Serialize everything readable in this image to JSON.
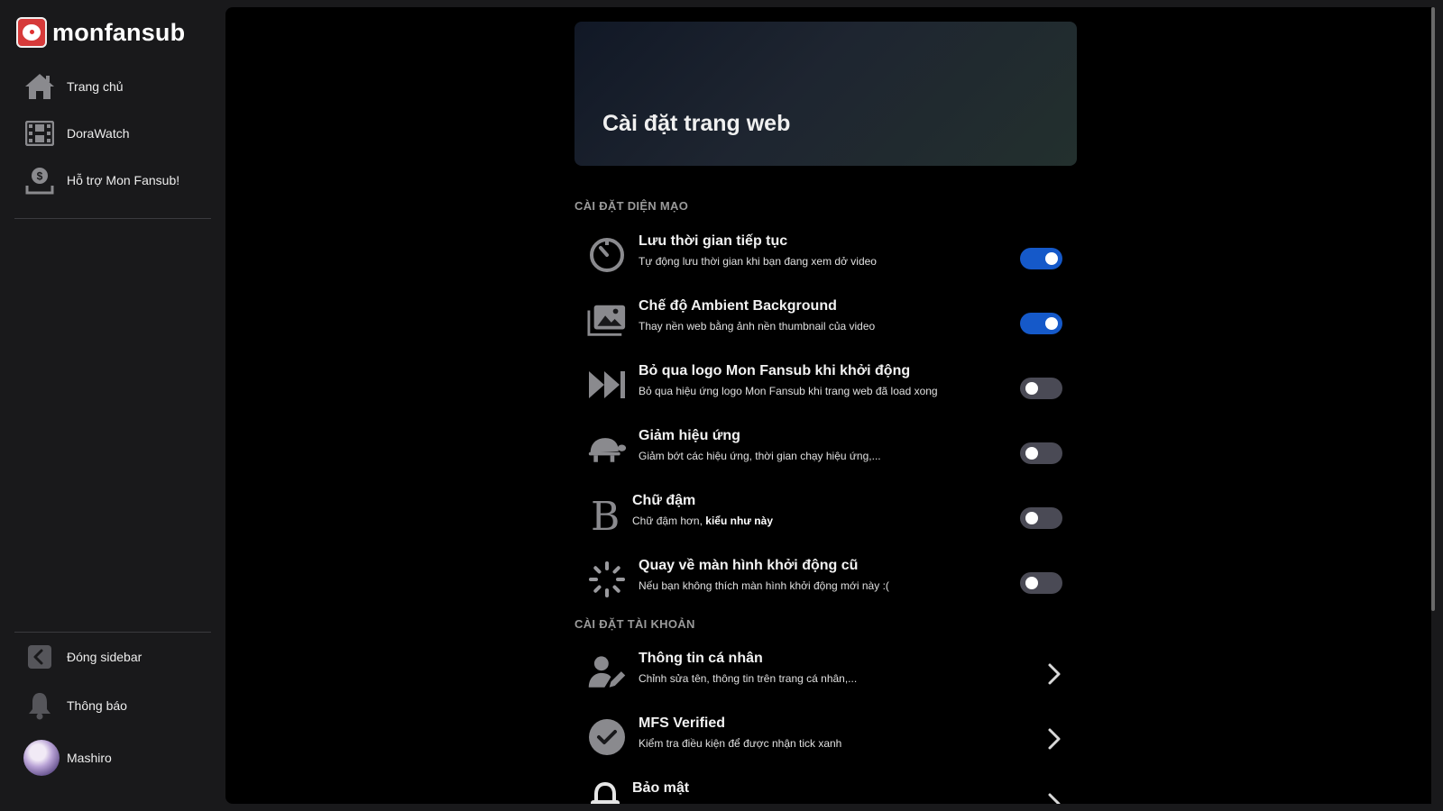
{
  "brand": {
    "name": "monfansub"
  },
  "sidebar": {
    "items": [
      {
        "label": "Trang chủ",
        "icon": "home-icon"
      },
      {
        "label": "DoraWatch",
        "icon": "film-icon"
      },
      {
        "label": "Hỗ trợ Mon Fansub!",
        "icon": "donate-icon"
      }
    ],
    "bottom": [
      {
        "label": "Đóng sidebar",
        "icon": "chevron-left-icon"
      },
      {
        "label": "Thông báo",
        "icon": "bell-icon"
      },
      {
        "label": "Mashiro",
        "icon": "avatar"
      }
    ]
  },
  "page": {
    "title": "Cài đặt trang web"
  },
  "sections": {
    "appearance": {
      "title": "CÀI ĐẶT DIỆN MẠO",
      "items": [
        {
          "title": "Lưu thời gian tiếp tục",
          "desc": "Tự động lưu thời gian khi bạn đang xem dở video",
          "enabled": true,
          "icon": "timer-icon"
        },
        {
          "title": "Chế độ Ambient Background",
          "desc": "Thay nền web bằng ảnh nền thumbnail của video",
          "enabled": true,
          "icon": "image-stack-icon"
        },
        {
          "title": "Bỏ qua logo Mon Fansub khi khởi động",
          "desc": "Bỏ qua hiệu ứng logo Mon Fansub khi trang web đã load xong",
          "enabled": false,
          "icon": "skip-forward-icon"
        },
        {
          "title": "Giảm hiệu ứng",
          "desc": "Giảm bớt các hiệu ứng, thời gian chạy hiệu ứng,...",
          "enabled": false,
          "icon": "turtle-icon"
        },
        {
          "title": "Chữ đậm",
          "desc": "Chữ đậm hơn, ",
          "desc_bold": "kiểu như này",
          "enabled": false,
          "icon": "bold-icon"
        },
        {
          "title": "Quay về màn hình khởi động cũ",
          "desc": "Nếu bạn không thích màn hình khởi động mới này :(",
          "enabled": false,
          "icon": "loading-spinner-icon"
        }
      ]
    },
    "account": {
      "title": "CÀI ĐẶT TÀI KHOẢN",
      "items": [
        {
          "title": "Thông tin cá nhân",
          "desc": "Chỉnh sửa tên, thông tin trên trang cá nhân,...",
          "icon": "user-edit-icon"
        },
        {
          "title": "MFS Verified",
          "desc": "Kiểm tra điều kiện để được nhận tick xanh",
          "icon": "check-circle-icon"
        },
        {
          "title": "Bảo mật",
          "desc": "",
          "icon": "lock-icon"
        }
      ]
    }
  },
  "colors": {
    "accent": "#1559c9",
    "toggle_off": "#4a4a55",
    "background": "#000000",
    "sidebar": "#19191b"
  }
}
